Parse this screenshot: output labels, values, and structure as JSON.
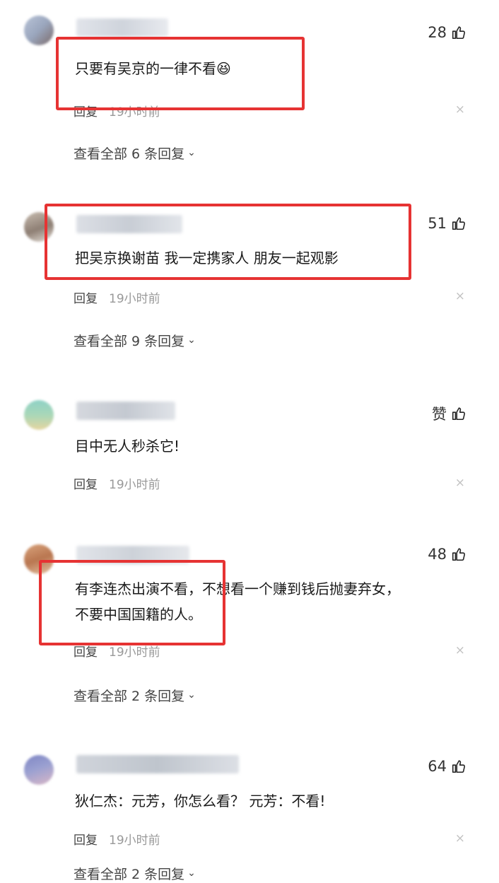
{
  "comments": [
    {
      "likes": "28",
      "text": "只要有吴京的一律不看",
      "emoji": "😆",
      "reply_label": "回复",
      "time": "19小时前",
      "close": "×",
      "replies": "查看全部 6 条回复"
    },
    {
      "likes": "51",
      "text": "把吴京换谢苗 我一定携家人 朋友一起观影",
      "reply_label": "回复",
      "time": "19小时前",
      "close": "×",
      "replies": "查看全部 9 条回复"
    },
    {
      "likes": "赞",
      "text": "目中无人秒杀它!",
      "reply_label": "回复",
      "time": "19小时前",
      "close": "×"
    },
    {
      "likes": "48",
      "text_line1": "有李连杰出演不看，不想看一个赚到钱后抛妻弃女，",
      "text_line2": "不要中国国籍的人。",
      "reply_label": "回复",
      "time": "19小时前",
      "close": "×",
      "replies": "查看全部 2 条回复"
    },
    {
      "likes": "64",
      "text": "狄仁杰：元芳，你怎么看？ 元芳：不看!",
      "reply_label": "回复",
      "time": "19小时前",
      "close": "×",
      "replies": "查看全部 2 条回复"
    }
  ],
  "icons": {
    "like": "thumbs-up-icon",
    "close": "close-icon",
    "expand": "chevron-down-icon"
  },
  "colors": {
    "highlight_box": "#e63333",
    "meta": "#999999"
  }
}
